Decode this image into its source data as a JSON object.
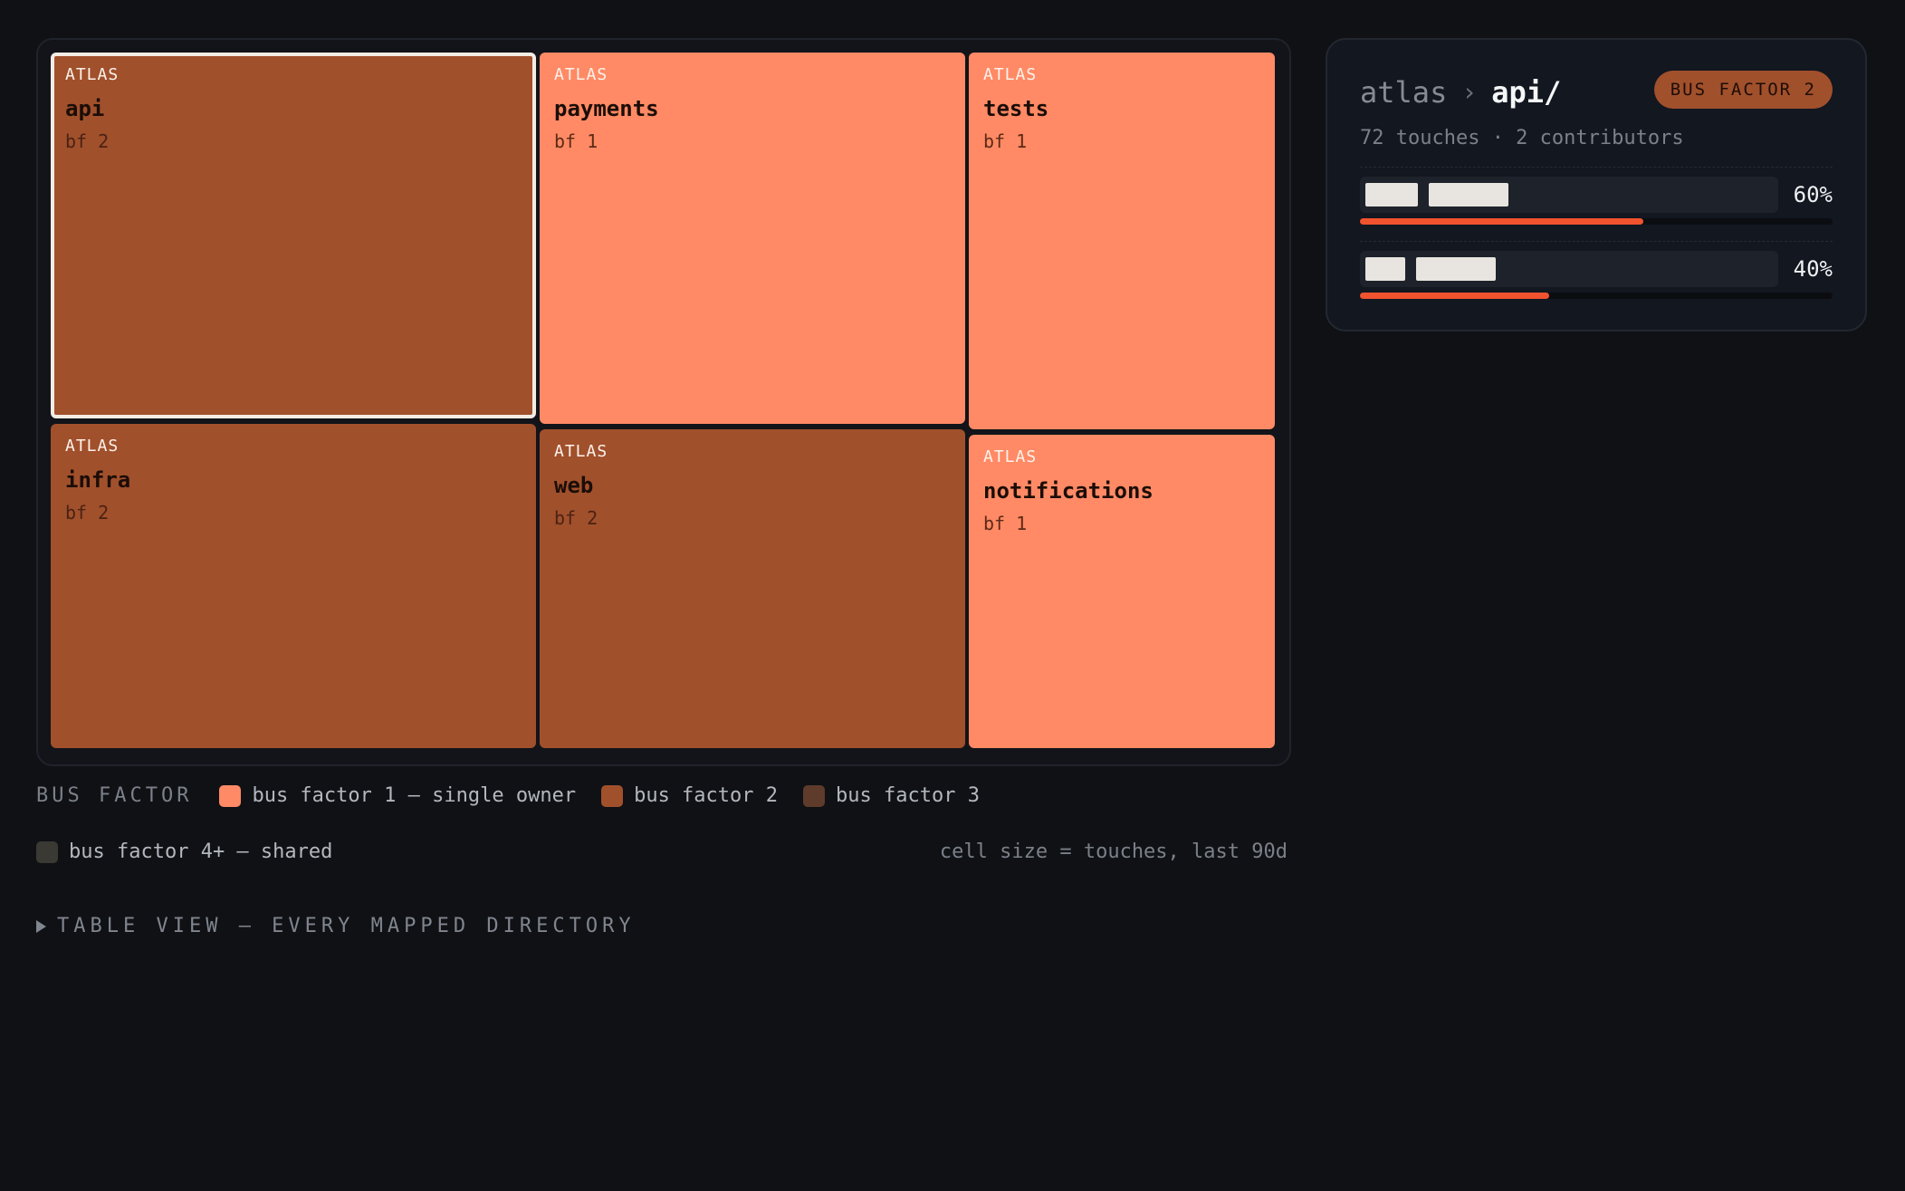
{
  "treemap": {
    "cells": [
      {
        "repo": "ATLAS",
        "dir": "api",
        "bf": "bf 2"
      },
      {
        "repo": "ATLAS",
        "dir": "payments",
        "bf": "bf 1"
      },
      {
        "repo": "ATLAS",
        "dir": "tests",
        "bf": "bf 1"
      },
      {
        "repo": "ATLAS",
        "dir": "infra",
        "bf": "bf 2"
      },
      {
        "repo": "ATLAS",
        "dir": "web",
        "bf": "bf 2"
      },
      {
        "repo": "ATLAS",
        "dir": "notifications",
        "bf": "bf 1"
      }
    ]
  },
  "legend": {
    "title": "BUS FACTOR",
    "items": [
      {
        "label": "bus factor 1 — single owner",
        "color": "#ff8a65"
      },
      {
        "label": "bus factor 2",
        "color": "#a1502c"
      },
      {
        "label": "bus factor 3",
        "color": "#5e3b2b"
      },
      {
        "label": "bus factor 4+ — shared",
        "color": "#3a3933"
      }
    ],
    "note": "cell size = touches, last 90d"
  },
  "table_toggle": "TABLE VIEW — EVERY MAPPED DIRECTORY",
  "panel": {
    "repo": "atlas",
    "separator": "›",
    "dir": "api/",
    "badge": "BUS FACTOR 2",
    "summary": "72 touches · 2 contributors",
    "contributors": [
      {
        "pct": "60%",
        "share": 0.6
      },
      {
        "pct": "40%",
        "share": 0.4
      }
    ]
  },
  "colors": {
    "bf1": "#ff8a65",
    "bf2": "#a1502c",
    "accent": "#f1532f"
  }
}
